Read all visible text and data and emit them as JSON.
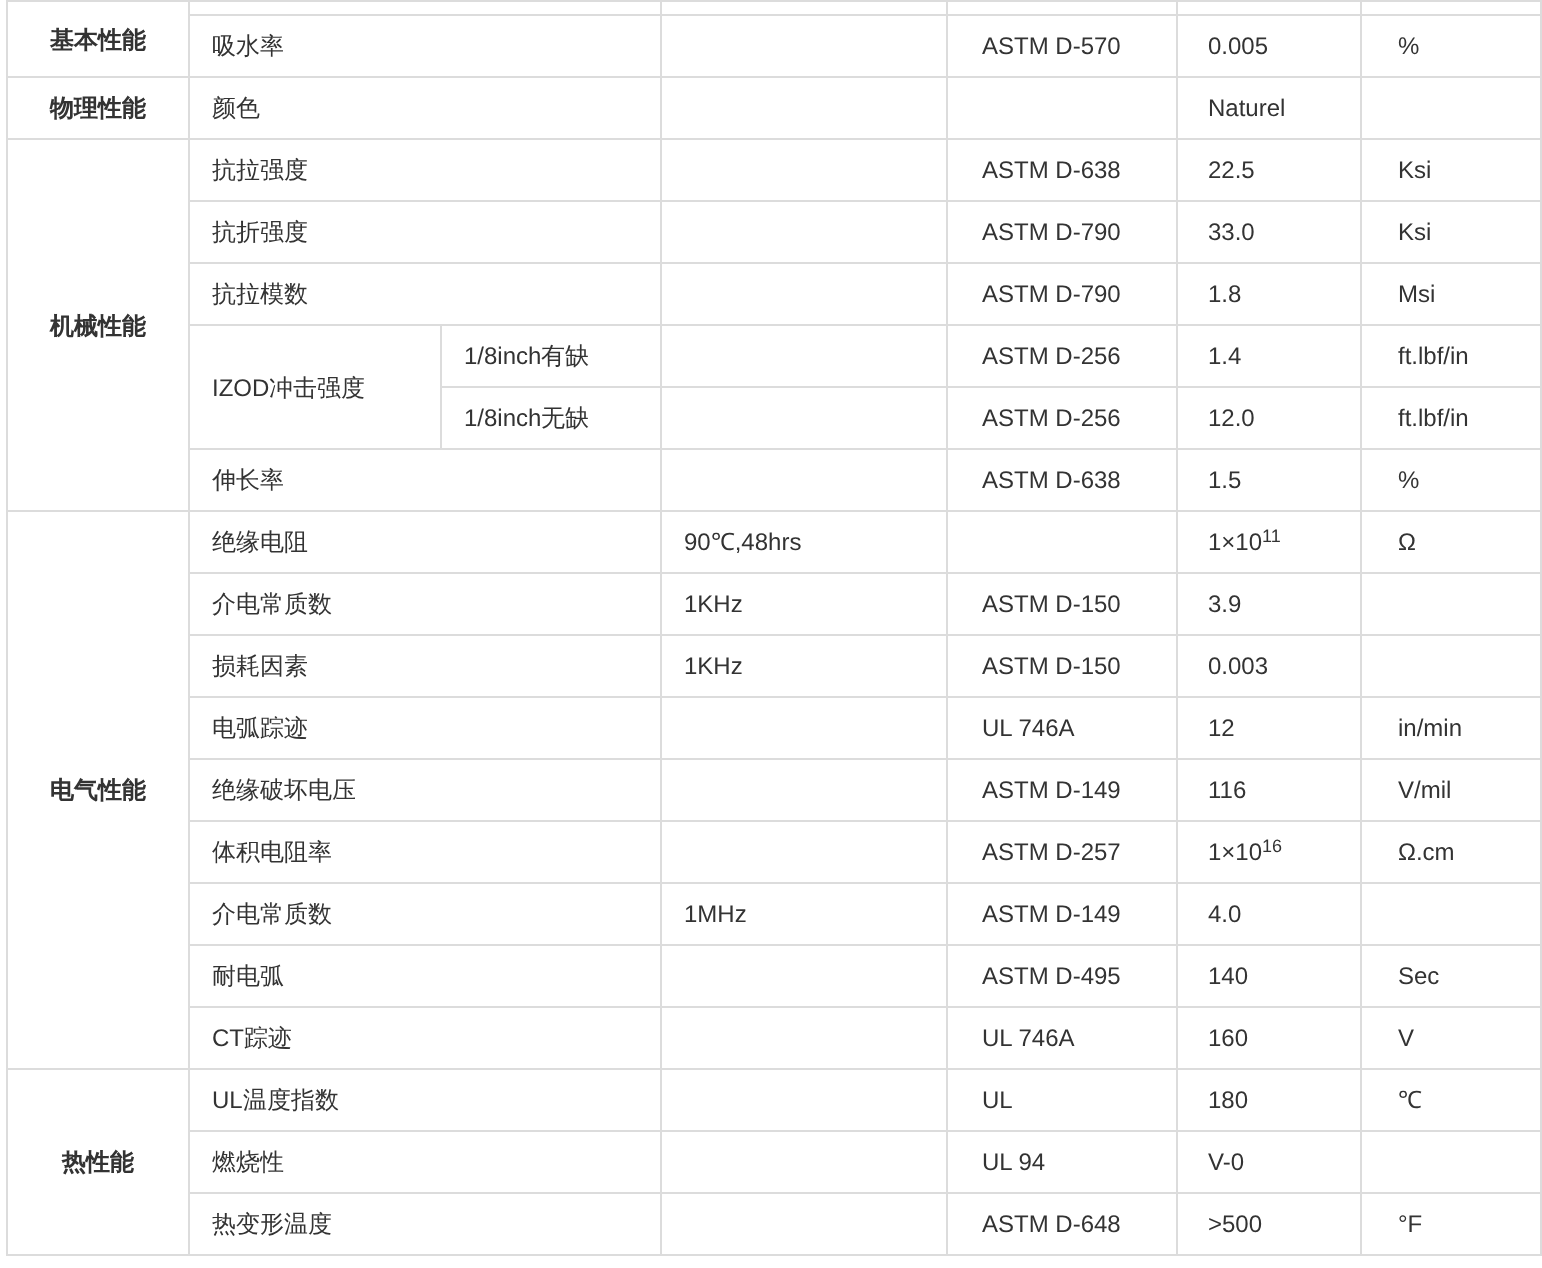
{
  "table": {
    "sections": [
      {
        "category": "基本性能",
        "rows": [
          {
            "kind": "plain",
            "property": "吸水率",
            "condition": "",
            "method": "ASTM D-570",
            "value": "0.005",
            "unit": "%"
          }
        ]
      },
      {
        "category": "物理性能",
        "rows": [
          {
            "kind": "plain",
            "property": "颜色",
            "condition": "",
            "method": "",
            "value": "Naturel",
            "unit": ""
          }
        ]
      },
      {
        "category": "机械性能",
        "rows": [
          {
            "kind": "plain",
            "property": "抗拉强度",
            "condition": "",
            "method": "ASTM D-638",
            "value": "22.5",
            "unit": "Ksi"
          },
          {
            "kind": "plain",
            "property": "抗折强度",
            "condition": "",
            "method": "ASTM D-790",
            "value": "33.0",
            "unit": "Ksi"
          },
          {
            "kind": "plain",
            "property": "抗拉模数",
            "condition": "",
            "method": "ASTM D-790",
            "value": "1.8",
            "unit": "Msi"
          },
          {
            "kind": "split",
            "property": "IZOD冲击强度",
            "parts": [
              {
                "label": "1/8inch有缺",
                "method": "ASTM D-256",
                "value": "1.4",
                "unit": "ft.lbf/in"
              },
              {
                "label": "1/8inch无缺",
                "method": "ASTM D-256",
                "value": "12.0",
                "unit": "ft.lbf/in"
              }
            ]
          },
          {
            "kind": "plain",
            "property": "伸长率",
            "condition": "",
            "method": "ASTM D-638",
            "value": "1.5",
            "unit": "%"
          }
        ]
      },
      {
        "category": "电气性能",
        "rows": [
          {
            "kind": "plain",
            "property": "绝缘电阻",
            "condition": "90℃,48hrs",
            "method": "",
            "value": "1×10$^{11}$",
            "unit": "Ω"
          },
          {
            "kind": "plain",
            "property": "介电常质数",
            "condition": "1KHz",
            "method": "ASTM D-150",
            "value": "3.9",
            "unit": ""
          },
          {
            "kind": "plain",
            "property": "损耗因素",
            "condition": "1KHz",
            "method": "ASTM D-150",
            "value": "0.003",
            "unit": ""
          },
          {
            "kind": "plain",
            "property": "电弧踪迹",
            "condition": "",
            "method": "UL 746A",
            "value": "12",
            "unit": "in/min"
          },
          {
            "kind": "plain",
            "property": "绝缘破坏电压",
            "condition": "",
            "method": "ASTM D-149",
            "value": "116",
            "unit": "V/mil"
          },
          {
            "kind": "plain",
            "property": "体积电阻率",
            "condition": "",
            "method": "ASTM D-257",
            "value": "1×10$^{16}$",
            "unit": "Ω.cm"
          },
          {
            "kind": "plain",
            "property": "介电常质数",
            "condition": "1MHz",
            "method": "ASTM D-149",
            "value": "4.0",
            "unit": ""
          },
          {
            "kind": "plain",
            "property": "耐电弧",
            "condition": "",
            "method": "ASTM D-495",
            "value": "140",
            "unit": "Sec"
          },
          {
            "kind": "plain",
            "property": "CT踪迹",
            "condition": "",
            "method": "UL 746A",
            "value": "160",
            "unit": "V"
          }
        ]
      },
      {
        "category": "热性能",
        "rows": [
          {
            "kind": "plain",
            "property": "UL温度指数",
            "condition": "",
            "method": "UL",
            "value": "180",
            "unit": "℃"
          },
          {
            "kind": "plain",
            "property": "燃烧性",
            "condition": "",
            "method": "UL 94",
            "value": "V-0",
            "unit": ""
          },
          {
            "kind": "plain",
            "property": "热变形温度",
            "condition": "",
            "method": "ASTM D-648",
            "value": ">500",
            "unit": "°F"
          }
        ]
      }
    ]
  }
}
